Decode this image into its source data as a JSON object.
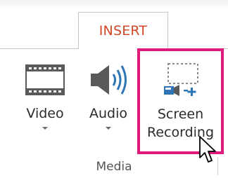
{
  "tab": {
    "label": "INSERT",
    "color": "#d24726"
  },
  "commands": {
    "video": {
      "label": "Video",
      "icon": "film-icon",
      "has_dropdown": true
    },
    "audio": {
      "label": "Audio",
      "icon": "speaker-icon",
      "has_dropdown": true
    },
    "screen_recording": {
      "label_line1": "Screen",
      "label_line2": "Recording",
      "icon": "screen-recording-icon",
      "highlight_color": "#e0197d"
    }
  },
  "group": {
    "label": "Media"
  },
  "cursor": {
    "icon": "mouse-pointer-icon"
  }
}
